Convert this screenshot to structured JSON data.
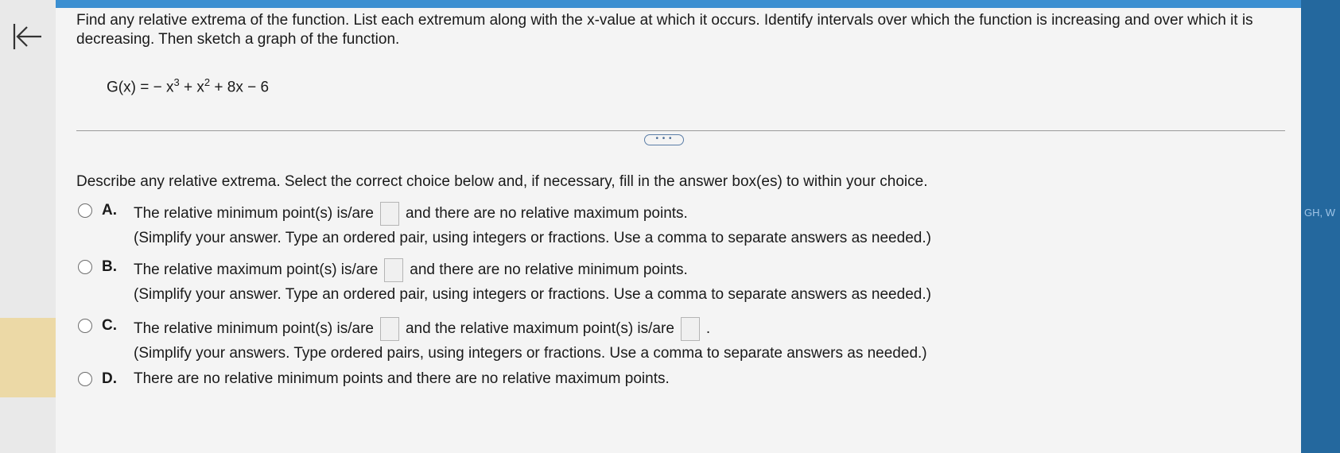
{
  "problem": {
    "prompt": "Find any relative extrema of the function. List each extremum along with the x-value at which it occurs. Identify intervals over which the function is increasing and over which it is decreasing. Then sketch a graph of the function.",
    "function_lhs": "G(x) = − x",
    "exp1": "3",
    "mid1": "+ x",
    "exp2": "2",
    "tail": "+ 8x − 6"
  },
  "expand_label": "• • •",
  "instruction": "Describe any relative extrema. Select the correct choice below and, if necessary, fill in the answer box(es) to within your choice.",
  "side_tab": "GH, W",
  "choices": {
    "a": {
      "letter": "A.",
      "pre": "The relative minimum point(s) is/are",
      "post": "and there are no relative maximum points.",
      "hint": "(Simplify your answer. Type an ordered pair, using integers or fractions. Use a comma to separate answers as needed.)"
    },
    "b": {
      "letter": "B.",
      "pre": "The relative maximum point(s) is/are",
      "post": "and there are no relative minimum points.",
      "hint": "(Simplify your answer. Type an ordered pair, using integers or fractions. Use a comma to separate answers as needed.)"
    },
    "c": {
      "letter": "C.",
      "pre": "The relative minimum point(s) is/are",
      "mid": "and the relative maximum point(s) is/are",
      "end": ".",
      "hint": "(Simplify your answers. Type ordered pairs, using integers or fractions. Use a comma to separate answers as needed.)"
    },
    "d": {
      "letter": "D.",
      "text": "There are no relative minimum points and there are no relative maximum points."
    }
  }
}
